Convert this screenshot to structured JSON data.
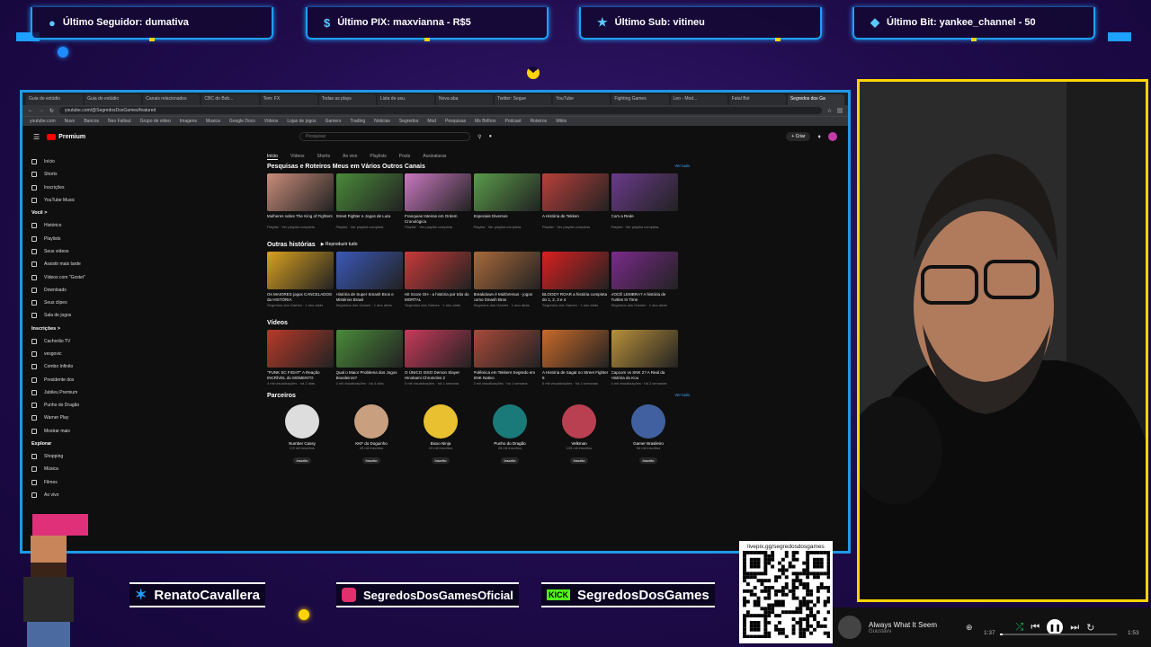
{
  "alerts": [
    {
      "icon": "user-icon",
      "label": "Último Seguidor: dumativa"
    },
    {
      "icon": "dollar-icon",
      "label": "Último PIX: maxvianna - R$5"
    },
    {
      "icon": "star-icon",
      "label": "Último Sub: vitineu"
    },
    {
      "icon": "diamond-icon",
      "label": "Último Bit: yankee_channel - 50"
    }
  ],
  "browser": {
    "tabs": [
      "Guia do estúdio",
      "Guia do estúdio",
      "Canais relacionados",
      "CBC do Bob...",
      "Tem: FX",
      "Todas as plays",
      "Lista de usu.",
      "Nova aba",
      "Twitter: Segue",
      "YouTube",
      "Fighting Games",
      "Leo - Mod...",
      "Fatal Bot",
      "Segredos dos Ga"
    ],
    "url": "youtube.com/@SegredosDosGames/featured",
    "bookmarks": [
      "youtube.com",
      "Nuvo",
      "Bancos",
      "Neo Fallout",
      "Grupo de video",
      "Imagens",
      "Musica",
      "Google Docs",
      "Vídeos",
      "Lojas de jogos",
      "Gamers",
      "Trading",
      "Noticias",
      "Segredos",
      "Mod",
      "Pesquisas",
      "Ms Brilhos",
      "Podcast",
      "Roteiros",
      "Wikis"
    ]
  },
  "youtube": {
    "brand": "Premium",
    "search_placeholder": "Pesquisar",
    "create": "+ Criar",
    "sidebar_main": [
      "Início",
      "Shorts",
      "Inscrições",
      "YouTube Music"
    ],
    "sidebar_you_head": "Você >",
    "sidebar_you": [
      "Histórico",
      "Playlists",
      "Seus vídeos",
      "Assistir mais tarde",
      "Vídeos com \"Gostei\"",
      "Downloads",
      "Seus clipes",
      "Sala de jogos"
    ],
    "sidebar_subs_head": "Inscrições >",
    "sidebar_subs": [
      "Cachorão TV",
      "vesgovic",
      "Combo Infinito",
      "Presidente dos",
      "Jubileu Premium",
      "Punho do Dragão",
      "Warner Play",
      "Mostrar mais"
    ],
    "sidebar_explore_head": "Explorar",
    "sidebar_explore": [
      "Shopping",
      "Música",
      "Filmes",
      "Ao vivo"
    ],
    "channel_tabs": [
      "Início",
      "Vídeos",
      "Shorts",
      "Ao vivo",
      "Playlists",
      "Posts",
      "Assinaturas"
    ],
    "sections": [
      {
        "title": "Pesquisas e Roteiros Meus em Vários Outros Canais",
        "see_all": "Ver tudo",
        "videos": [
          {
            "title": "Mulheres sobre The King of Fighters",
            "meta": "Playlist · Ver playlist completa",
            "color": "#c98c7a"
          },
          {
            "title": "Street Fighter e Jogos de Luta",
            "meta": "Playlist · Ver playlist completa",
            "color": "#4a8a3a"
          },
          {
            "title": "Franquias Inteiras em Ordem Cronológica",
            "meta": "Playlist · Ver playlist completa",
            "color": "#c878c0"
          },
          {
            "title": "Especiais Diversos",
            "meta": "Playlist · Ver playlist completa",
            "color": "#5a9a4a"
          },
          {
            "title": "A História de Tekken",
            "meta": "Playlist · Ver playlist completa",
            "color": "#b8403a"
          },
          {
            "title": "Com a Rede",
            "meta": "Playlist · Ver playlist completa",
            "color": "#6a3a8a"
          }
        ]
      },
      {
        "title": "Outras histórias",
        "play_all": "Reproduzir tudo",
        "videos": [
          {
            "title": "Os MAIORES jogos CANCELADOS da HISTÓRIA",
            "meta": "Segredos dos Games · 1 ano atrás",
            "color": "#d8a020"
          },
          {
            "title": "História de Super Smash Bros e Mistérios Brawl",
            "meta": "Segredos dos Games · 1 ano atrás",
            "color": "#3a58b8"
          },
          {
            "title": "Hit Score GH - a história por trás do MORTAL",
            "meta": "Segredos dos Games · 1 ano atrás",
            "color": "#c83a3a"
          },
          {
            "title": "Breakdown é MultiVersus - jogos como Smash Bros",
            "meta": "Segredos dos Games · 1 ano atrás",
            "color": "#a86a3a"
          },
          {
            "title": "BLOODY ROAR a história completa do 1, 2, 3 e 4",
            "meta": "Segredos dos Games · 1 ano atrás",
            "color": "#d82020"
          },
          {
            "title": "VOCÊ LEMBRA? A história de Turtles In Time",
            "meta": "Segredos dos Games · 1 ano atrás",
            "color": "#7a2a8a"
          }
        ]
      },
      {
        "title": "Vídeos",
        "videos": [
          {
            "title": "\"PUNK SC FIGHT\" A Reação INCRÍVEL do MOMENTO",
            "meta": "4 mil visualizações · há 2 dias",
            "color": "#b83a2a"
          },
          {
            "title": "Qual o Maior Problema dos Jogos Brasileiros?",
            "meta": "2 mil visualizações · há 4 dias",
            "color": "#4a8a3a"
          },
          {
            "title": "O ÚNICO ISSO Demon Slayer Hinokami Chronicles 2",
            "meta": "5 mil visualizações · há 1 semana",
            "color": "#c83a5a"
          },
          {
            "title": "Polêmica em Tekken! Segredo em SNK Nativo",
            "meta": "3 mil visualizações · há 1 semana",
            "color": "#a84a3a"
          },
          {
            "title": "A História de Sagat no Street Fighter 6",
            "meta": "6 mil visualizações · há 2 semanas",
            "color": "#c86a2a"
          },
          {
            "title": "Capcom vs SNK 2? A Real da História do Kou",
            "meta": "4 mil visualizações · há 2 semanas",
            "color": "#b8903a"
          }
        ]
      }
    ],
    "partners_title": "Parceiros",
    "partners_see_all": "Ver tudo",
    "partners": [
      {
        "name": "Number Cassy",
        "subs": "2,9 mil inscritos",
        "color": "#dddddd"
      },
      {
        "name": "KKF do Doguinho",
        "subs": "49 mil inscritos",
        "color": "#c8a080"
      },
      {
        "name": "Bixxo Ninja",
        "subs": "19 mil inscritos",
        "color": "#e8c030"
      },
      {
        "name": "Punho do Dragão",
        "subs": "28 mil inscritos",
        "color": "#1a7a7a"
      },
      {
        "name": "Velkman",
        "subs": "105 mil inscritos",
        "color": "#b84050"
      },
      {
        "name": "Gamer Brasileiro",
        "subs": "54 mil inscritos",
        "color": "#4060a0"
      }
    ],
    "partner_button": "Inscrito"
  },
  "social": [
    {
      "icon": "twitter-icon",
      "handle": "RenatoCavallera",
      "color": "#1da1f2"
    },
    {
      "icon": "instagram-icon",
      "handle": "SegredosDosGamesOficial",
      "color": "#e1306c"
    },
    {
      "icon": "kick-icon",
      "handle": "SegredosDosGames",
      "color": "#53fc18"
    }
  ],
  "qr": {
    "label": "livepix.gg/segredosdosgames"
  },
  "music": {
    "title": "Always What It Seem",
    "artist": "Guustavv",
    "elapsed": "1:37",
    "duration": "1:53",
    "progress": 0.02
  }
}
